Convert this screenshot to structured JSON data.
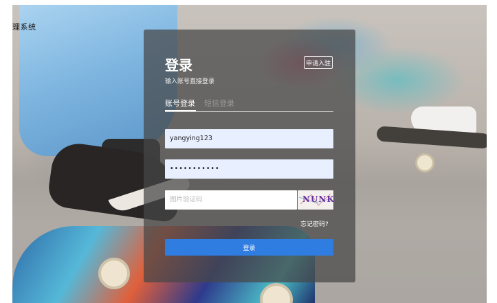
{
  "app": {
    "title": "理系统"
  },
  "login": {
    "heading": "登录",
    "apply_label": "申请入驻",
    "subtitle": "输入账号直接登录",
    "tabs": [
      {
        "label": "账号登录",
        "active": true
      },
      {
        "label": "短信登录",
        "active": false
      }
    ],
    "username_value": "yangying123",
    "password_value": "•••••••••••",
    "captcha_placeholder": "图片验证码",
    "captcha_text": "NUNK",
    "forgot_label": "忘记密码?",
    "submit_label": "登录"
  },
  "colors": {
    "primary_button": "#2f7de1",
    "panel_overlay": "rgba(70,70,70,0.72)",
    "input_fill": "#e8efff"
  }
}
